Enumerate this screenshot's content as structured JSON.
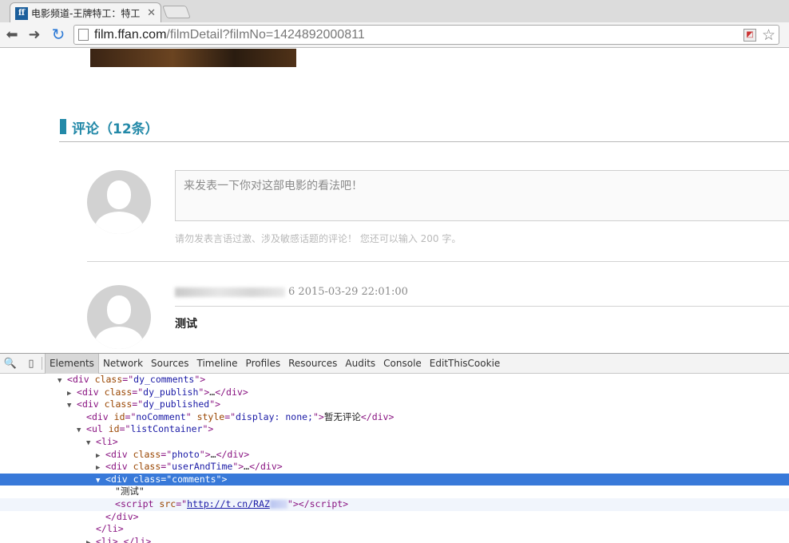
{
  "browser": {
    "tab_title": "电影频道-王牌特工：特工",
    "favicon_text": "ff",
    "url_host": "film.ffan.com",
    "url_path": "/filmDetail?filmNo=1424892000811"
  },
  "page": {
    "section_title": "评论（12条）",
    "comment_placeholder": "来发表一下你对这部电影的看法吧！",
    "hint": "请勿发表言语过激、涉及敏感话题的评论！ 您还可以输入 200 字。",
    "comments": [
      {
        "user_suffix": "6",
        "datetime": "2015-03-29 22:01:00",
        "text": "测试"
      }
    ]
  },
  "devtools": {
    "tabs": [
      "Elements",
      "Network",
      "Sources",
      "Timeline",
      "Profiles",
      "Resources",
      "Audits",
      "Console",
      "EditThisCookie"
    ],
    "active_tab": "Elements",
    "tree": {
      "l0": {
        "tag": "div",
        "attr": "class",
        "val": "dy_comments"
      },
      "l1": {
        "tag": "div",
        "attr": "class",
        "val": "dy_publish",
        "close": "div"
      },
      "l2": {
        "tag": "div",
        "attr": "class",
        "val": "dy_published"
      },
      "l3": {
        "tag": "div",
        "attr1": "id",
        "val1": "noComment",
        "attr2": "style",
        "val2": "display: none;",
        "text": "暂无评论",
        "close": "div"
      },
      "l4": {
        "tag": "ul",
        "attr": "id",
        "val": "listContainer"
      },
      "l5": {
        "tag": "li"
      },
      "l6": {
        "tag": "div",
        "attr": "class",
        "val": "photo",
        "close": "div"
      },
      "l7": {
        "tag": "div",
        "attr": "class",
        "val": "userAndTime",
        "close": "div"
      },
      "l8": {
        "tag": "div",
        "attr": "class",
        "val": "comments"
      },
      "l9": {
        "text": "\"测试\""
      },
      "l10": {
        "tag": "script",
        "attr": "src",
        "link": "http://t.cn/RAZ",
        "close": "script"
      },
      "l11": {
        "close": "div"
      },
      "l12": {
        "close": "li"
      },
      "l13": {
        "tag": "li",
        "close": "li"
      }
    }
  },
  "colors": {
    "accent": "#2389a8",
    "selection": "#3879d9"
  }
}
